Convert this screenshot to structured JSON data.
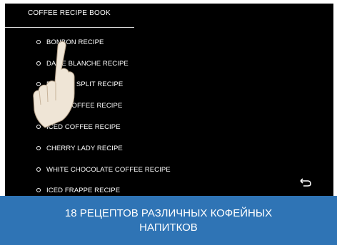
{
  "app": {
    "title": "COFFEE RECIPE BOOK"
  },
  "menu": {
    "items": [
      {
        "label": "BONBON RECIPE"
      },
      {
        "label": "DAME BLANCHE RECIPE"
      },
      {
        "label": "BANANA SPLIT RECIPE"
      },
      {
        "label": "IRISH COFFEE RECIPE"
      },
      {
        "label": "ICED COFFEE RECIPE"
      },
      {
        "label": "CHERRY LADY RECIPE"
      },
      {
        "label": "WHITE CHOCOLATE COFFEE RECIPE"
      },
      {
        "label": "ICED FRAPPE RECIPE"
      }
    ]
  },
  "icons": {
    "back": "return-arrow-icon",
    "pointer": "hand-pointer-icon"
  },
  "banner": {
    "line1": "18 РЕЦЕПТОВ РАЗЛИЧНЫХ КОФЕЙНЫХ",
    "line2": "НАПИТКОВ"
  },
  "colors": {
    "screen_bg": "#000000",
    "text": "#ffffff",
    "banner_bg": "#2f74b5"
  }
}
